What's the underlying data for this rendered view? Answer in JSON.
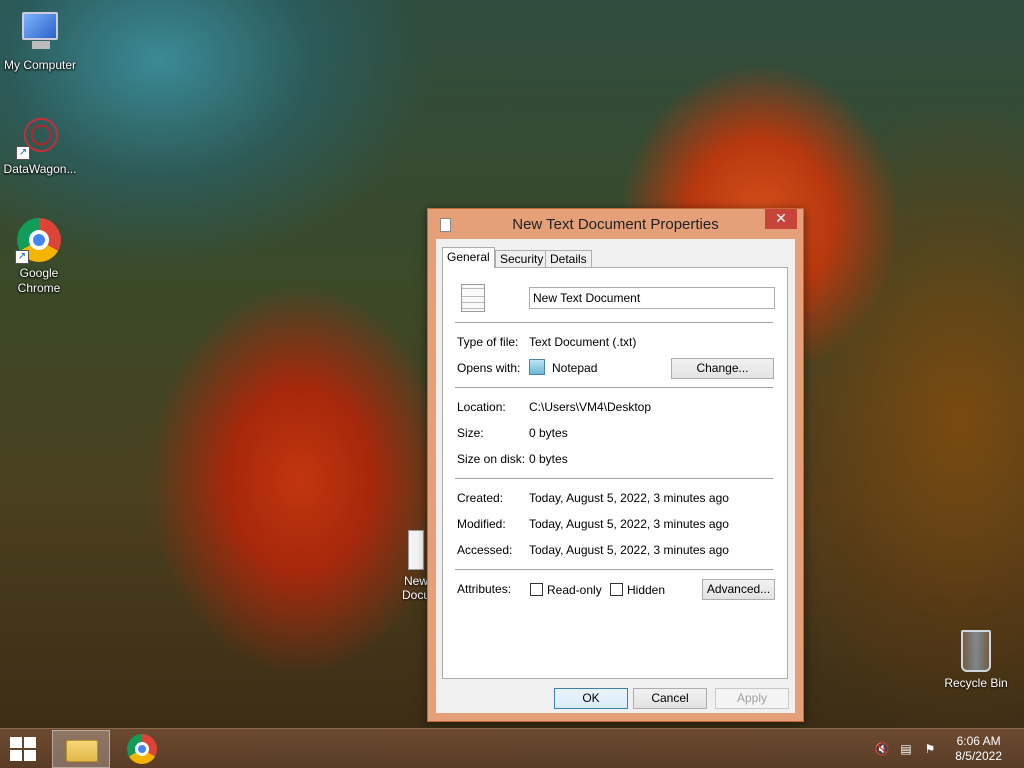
{
  "desktop": {
    "icons": [
      {
        "label": "My Computer"
      },
      {
        "label": "DataWagon..."
      },
      {
        "label": "Google Chrome"
      }
    ],
    "desktop_file_label": "New Docu",
    "recycle_bin_label": "Recycle Bin"
  },
  "dialog": {
    "title": "New Text Document Properties",
    "close_glyph": "✕",
    "tabs": [
      {
        "label": "General",
        "active": true
      },
      {
        "label": "Security",
        "active": false
      },
      {
        "label": "Details",
        "active": false
      }
    ],
    "file_name": "New Text Document",
    "type_of_file": {
      "label": "Type of file:",
      "value": "Text Document (.txt)"
    },
    "opens_with": {
      "label": "Opens with:",
      "value": "Notepad",
      "change_button": "Change..."
    },
    "location": {
      "label": "Location:",
      "value": "C:\\Users\\VM4\\Desktop"
    },
    "size": {
      "label": "Size:",
      "value": "0 bytes"
    },
    "size_on_disk": {
      "label": "Size on disk:",
      "value": "0 bytes"
    },
    "created": {
      "label": "Created:",
      "value": "Today, August 5, 2022, 3 minutes ago"
    },
    "modified": {
      "label": "Modified:",
      "value": "Today, August 5, 2022, 3 minutes ago"
    },
    "accessed": {
      "label": "Accessed:",
      "value": "Today, August 5, 2022, 3 minutes ago"
    },
    "attributes": {
      "label": "Attributes:",
      "read_only": {
        "label": "Read-only",
        "checked": false
      },
      "hidden": {
        "label": "Hidden",
        "checked": false
      },
      "advanced_button": "Advanced..."
    },
    "buttons": {
      "ok": "OK",
      "cancel": "Cancel",
      "apply": "Apply"
    }
  },
  "taskbar": {
    "clock_time": "6:06 AM",
    "clock_date": "8/5/2022"
  },
  "colors": {
    "window_frame": "#e5a07a",
    "close_button": "#c7443b",
    "taskbar": "#5a3c26"
  }
}
